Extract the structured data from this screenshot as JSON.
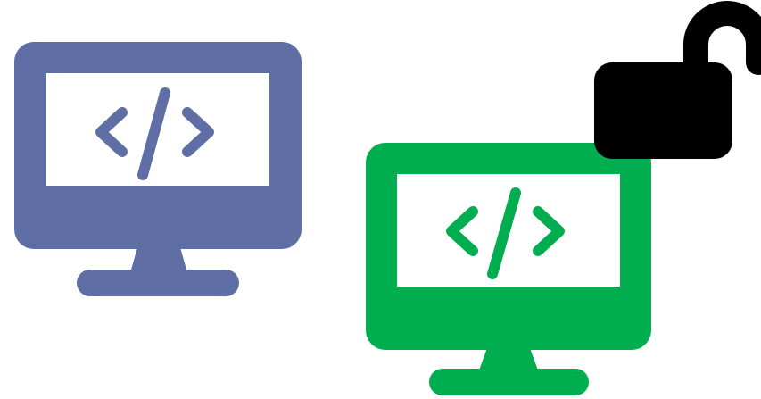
{
  "colors": {
    "background": "#ffffff",
    "monitor_left": "#5f6ea4",
    "monitor_right": "#00ad4f",
    "screen": "#ffffff",
    "padlock": "#000000"
  },
  "icons": [
    {
      "name": "code-monitor-icon",
      "color_key": "monitor_left"
    },
    {
      "name": "code-monitor-icon",
      "color_key": "monitor_right"
    },
    {
      "name": "unlocked-padlock-icon",
      "color_key": "padlock"
    }
  ]
}
